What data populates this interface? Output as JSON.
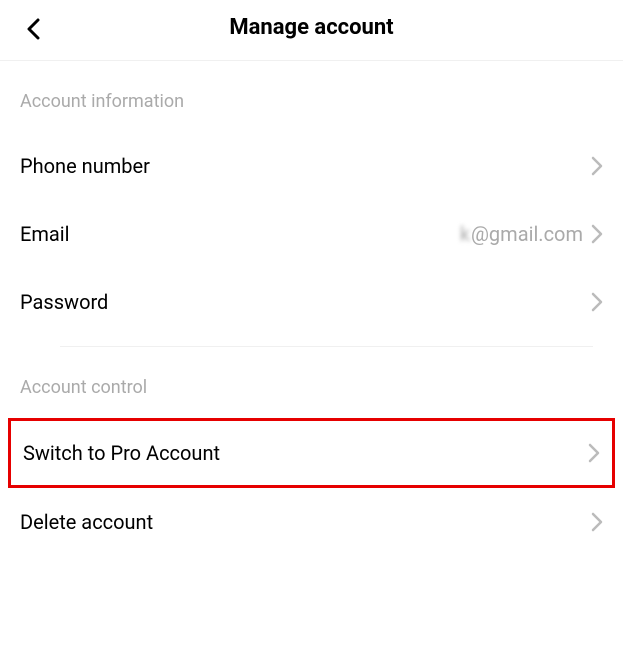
{
  "header": {
    "title": "Manage account"
  },
  "sections": {
    "account_info": {
      "header": "Account information",
      "phone_label": "Phone number",
      "email_label": "Email",
      "email_value_prefix": "k",
      "email_value_suffix": "@gmail.com",
      "password_label": "Password"
    },
    "account_control": {
      "header": "Account control",
      "switch_pro_label": "Switch to Pro Account",
      "delete_label": "Delete account"
    }
  }
}
